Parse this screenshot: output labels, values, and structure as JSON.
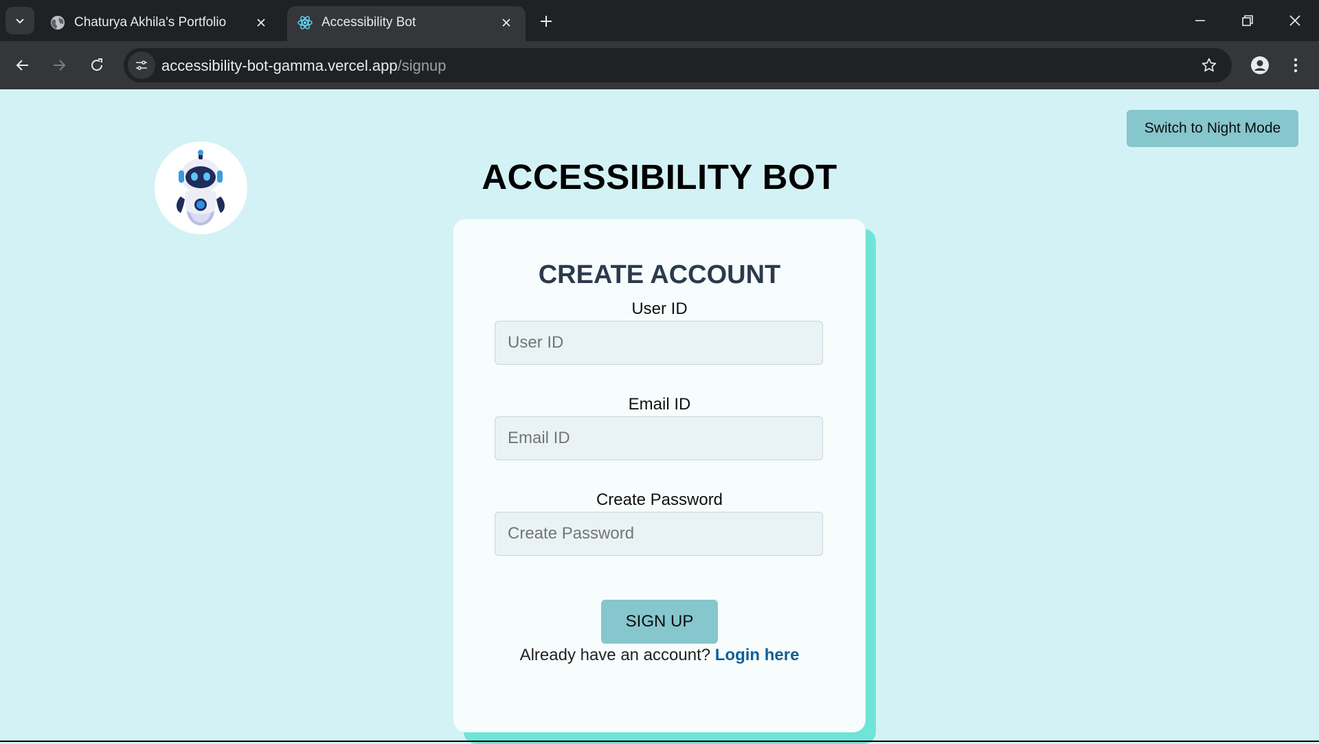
{
  "browser": {
    "tabs": [
      {
        "title": "Chaturya Akhila's Portfolio",
        "icon": "globe-icon",
        "active": false
      },
      {
        "title": "Accessibility Bot",
        "icon": "react-icon",
        "active": true
      }
    ],
    "url_host": "accessibility-bot-gamma.vercel.app",
    "url_path": "/signup"
  },
  "page": {
    "night_mode_label": "Switch to Night Mode",
    "app_title": "ACCESSIBILITY BOT",
    "logo_icon": "robot-icon",
    "background_color": "#d3f2f5",
    "accent_color": "#86c6cd",
    "card_shadow_color": "#6fe4d8"
  },
  "form": {
    "title": "CREATE ACCOUNT",
    "fields": [
      {
        "label": "User ID",
        "placeholder": "User ID",
        "value": ""
      },
      {
        "label": "Email ID",
        "placeholder": "Email ID",
        "value": ""
      },
      {
        "label": "Create Password",
        "placeholder": "Create Password",
        "value": ""
      }
    ],
    "submit_label": "SIGN UP",
    "login_prompt": "Already have an account?",
    "login_link": "Login here"
  }
}
